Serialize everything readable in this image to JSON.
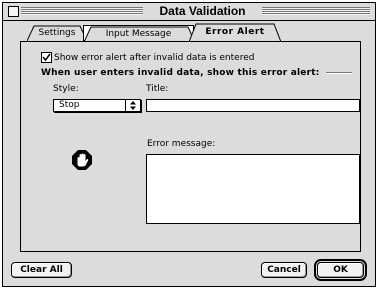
{
  "window": {
    "title": "Data Validation"
  },
  "tabs": [
    {
      "label": "Settings"
    },
    {
      "label": "Input Message"
    },
    {
      "label": "Error Alert"
    }
  ],
  "error_alert": {
    "show_checkbox_label": "Show error alert after invalid data is entered",
    "show_checked": true,
    "section_heading": "When user enters invalid data, show this error alert:",
    "style_label": "Style:",
    "style_value": "Stop",
    "style_icon": "stop-hand-icon",
    "title_label": "Title:",
    "title_value": "",
    "error_message_label": "Error message:",
    "error_message_value": ""
  },
  "buttons": {
    "clear_all": "Clear All",
    "cancel": "Cancel",
    "ok": "OK"
  }
}
